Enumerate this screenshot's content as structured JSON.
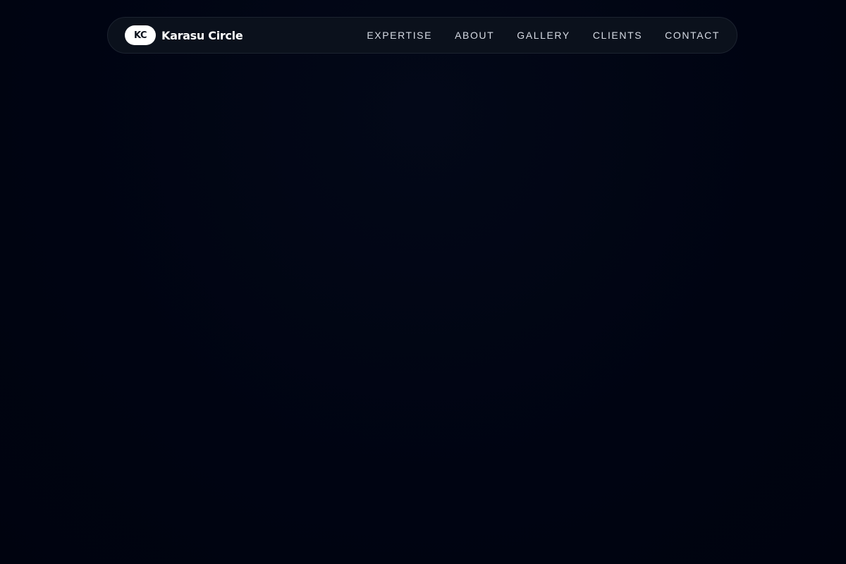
{
  "brand": {
    "badge": "KC",
    "name": "Karasu Circle"
  },
  "nav": {
    "items": [
      {
        "label": "EXPERTISE"
      },
      {
        "label": "ABOUT"
      },
      {
        "label": "GALLERY"
      },
      {
        "label": "CLIENTS"
      },
      {
        "label": "CONTACT"
      }
    ]
  },
  "colors": {
    "background": "#000515",
    "navbar": "#0b111c",
    "navbar_border": "#1c2330",
    "text": "#d6dbe4",
    "accent": "#ffffff"
  }
}
